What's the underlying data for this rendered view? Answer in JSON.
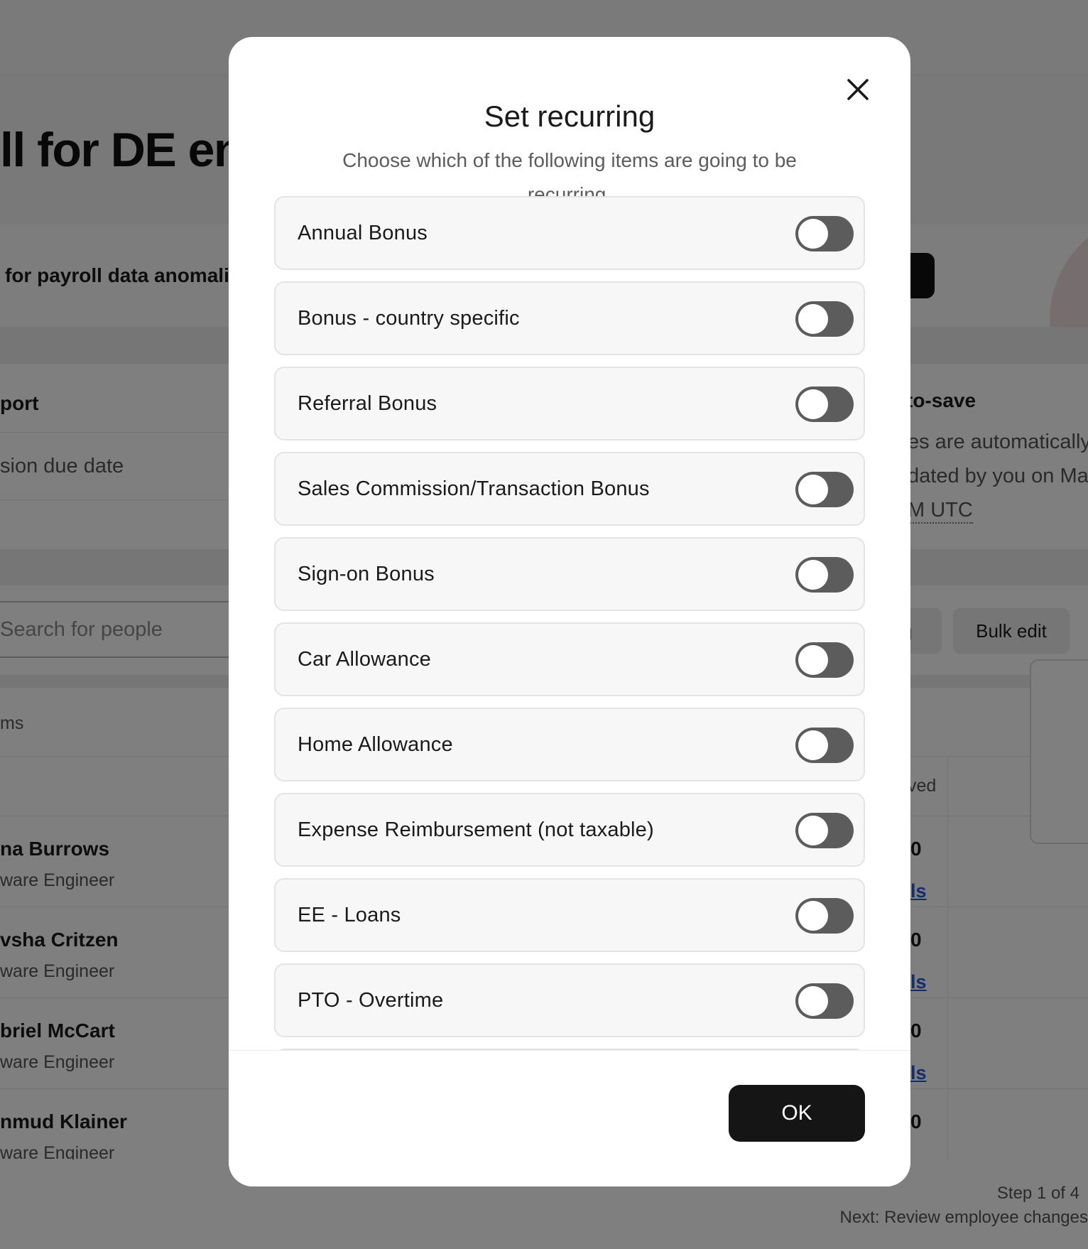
{
  "background": {
    "page_title": "ll for DE ent",
    "anomaly_text": "for payroll data anomali",
    "report_title": "port",
    "report_due": "sion due date",
    "autosave": {
      "title": "to-save",
      "line1": "es are automatically",
      "line2": "dated by you on Ma",
      "line3": "M UTC"
    },
    "search_placeholder": "Search for people",
    "filter_label": "g",
    "bulk_edit_label": "Bulk edit",
    "items_label": "ms",
    "column_header": "ved",
    "rows": [
      {
        "name": "na Burrows",
        "role": "ware Engineer",
        "value": "0",
        "link": "ls"
      },
      {
        "name": "vsha Critzen",
        "role": "ware Engineer",
        "value": "0",
        "link": "ls"
      },
      {
        "name": "briel McCart",
        "role": "ware Engineer",
        "value": "0",
        "link": "ls"
      },
      {
        "name": "nmud Klainer",
        "role": "ware Engineer",
        "value": "0",
        "link": ""
      }
    ],
    "step": "Step 1 of 4",
    "next": "Next: Review employee changes"
  },
  "modal": {
    "title": "Set recurring",
    "subtitle": "Choose which of the following items are going to be recurring.",
    "close_icon": "close-icon",
    "items": [
      {
        "label": "Annual Bonus",
        "recurring": false
      },
      {
        "label": "Bonus - country specific",
        "recurring": false
      },
      {
        "label": "Referral Bonus",
        "recurring": false
      },
      {
        "label": "Sales Commission/Transaction Bonus",
        "recurring": false
      },
      {
        "label": "Sign-on Bonus",
        "recurring": false
      },
      {
        "label": "Car Allowance",
        "recurring": false
      },
      {
        "label": "Home Allowance",
        "recurring": false
      },
      {
        "label": "Expense Reimbursement (not taxable)",
        "recurring": false
      },
      {
        "label": "EE - Loans",
        "recurring": false
      },
      {
        "label": "PTO - Overtime",
        "recurring": false
      }
    ],
    "ok_label": "OK"
  }
}
